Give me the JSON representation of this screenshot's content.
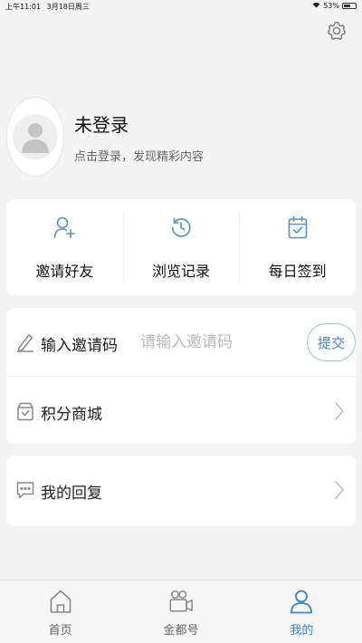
{
  "status_bar": {
    "time": "上午11:01",
    "date": "3月18日周三",
    "battery": "53%"
  },
  "profile": {
    "name": "未登录",
    "subtitle": "点击登录，发现精彩内容"
  },
  "quick_actions": [
    {
      "label": "邀请好友",
      "icon": "add-user-icon"
    },
    {
      "label": "浏览记录",
      "icon": "history-icon"
    },
    {
      "label": "每日签到",
      "icon": "calendar-check-icon"
    }
  ],
  "invite": {
    "label": "输入邀请码",
    "placeholder": "请输入邀请码",
    "submit": "提交"
  },
  "menu": [
    {
      "label": "积分商城",
      "icon": "shop-icon"
    },
    {
      "label": "我的回复",
      "icon": "comment-icon"
    }
  ],
  "tabs": [
    {
      "label": "首页",
      "icon": "home-icon"
    },
    {
      "label": "金都号",
      "icon": "video-camera-icon"
    },
    {
      "label": "我的",
      "icon": "user-icon",
      "active": true
    }
  ],
  "colors": {
    "accent": "#3f82c0",
    "icon": "#5b8fbc",
    "background": "#f4f4f4"
  }
}
